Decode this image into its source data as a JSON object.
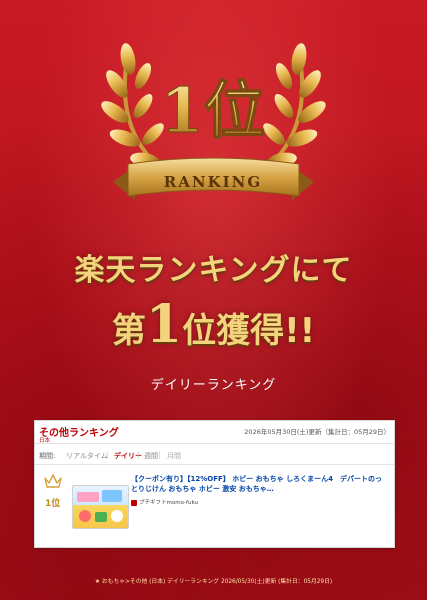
{
  "badge": {
    "rank_text": "1位",
    "ribbon_text": "RANKING"
  },
  "headline": {
    "line1": "楽天ランキングにて",
    "line2_prefix": "第",
    "line2_num": "1",
    "line2_suffix": "位獲得!!"
  },
  "subtitle": "デイリーランキング",
  "card": {
    "title": "その他ランキング",
    "updated": "2026年05月30日(土)更新（集計日：05月29日）",
    "region": "日本",
    "tabs": {
      "label": "期間:",
      "realtime": "リアルタイム",
      "daily": "デイリー",
      "weekly": "週間",
      "monthly": "月間",
      "separator": "|"
    },
    "item": {
      "rank": "1位",
      "title": "【クーポン有り】【12%OFF】 ホビー おもちゃ しろくまーん4　デパートのっとりじけん おもちゃ ホビー 激安 おもちゃ…",
      "shop": "プチギフトmomo-fuku"
    }
  },
  "footer": "★ おもちゃ>その他 (日本) デイリーランキング 2026/05/30(土)更新 (集計日：05月29日)",
  "colors": {
    "accent_red": "#bf0000",
    "gold": "#f3d37c",
    "background": "#b5121c"
  }
}
